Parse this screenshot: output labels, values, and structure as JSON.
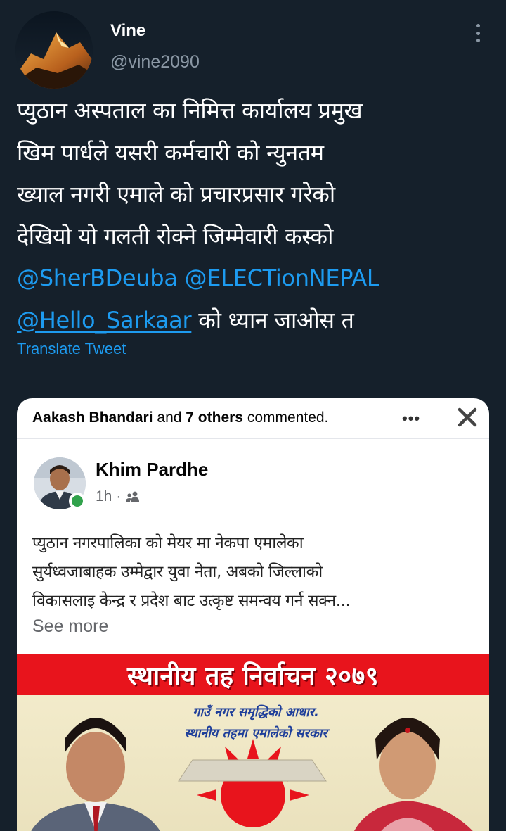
{
  "tweet": {
    "author_name": "Vine",
    "author_handle": "@vine2090",
    "more_icon": "more-vertical-icon",
    "text_lines": [
      "प्युठान अस्पताल का निमित्त कार्यालय प्रमुख",
      "खिम पार्धले यसरी कर्मचारी को न्युनतम",
      "ख्याल नगरी एमाले को प्रचारप्रसार गरेको",
      "देखियो यो गलती रोक्ने जिम्मेवारी कस्को"
    ],
    "mention_1": "@SherBDeuba",
    "mention_2": "@ELECTionNEPAL",
    "mention_3": "@Hello_Sarkaar",
    "text_tail": "को ध्यान जाओस त",
    "translate_label": "Translate Tweet",
    "accent_color": "#1d9bf0",
    "background_color": "#15202b"
  },
  "facebook_card": {
    "commenter": "Aakash Bhandari",
    "joiner": "and",
    "others": "7 others",
    "commented": "commented.",
    "dots_label": "•••",
    "close_icon": "close-icon",
    "post_author": "Khim Pardhe",
    "post_time": "1h",
    "separator": "·",
    "audience_icon": "friends-icon",
    "post_lines": [
      "प्युठान नगरपालिका को मेयर मा नेकपा एमालेका",
      "सुर्यध्वजाबाहक उम्मेद्वार युवा नेता, अबको जिल्लाको",
      "विकासलाइ केन्द्र र प्रदेश बाट उत्कृष्ट  समन्वय गर्न सक्न..."
    ],
    "see_more": "See more"
  },
  "poster": {
    "title": "स्थानीय तह निर्वाचन २०७९",
    "slogan_1": "गाउँ नगर समृद्धिको आधार.",
    "slogan_2": "स्थानीय तहमा एमालेको सरकार",
    "banner_color": "#e8141c",
    "slogan_color": "#1f3f9a"
  }
}
